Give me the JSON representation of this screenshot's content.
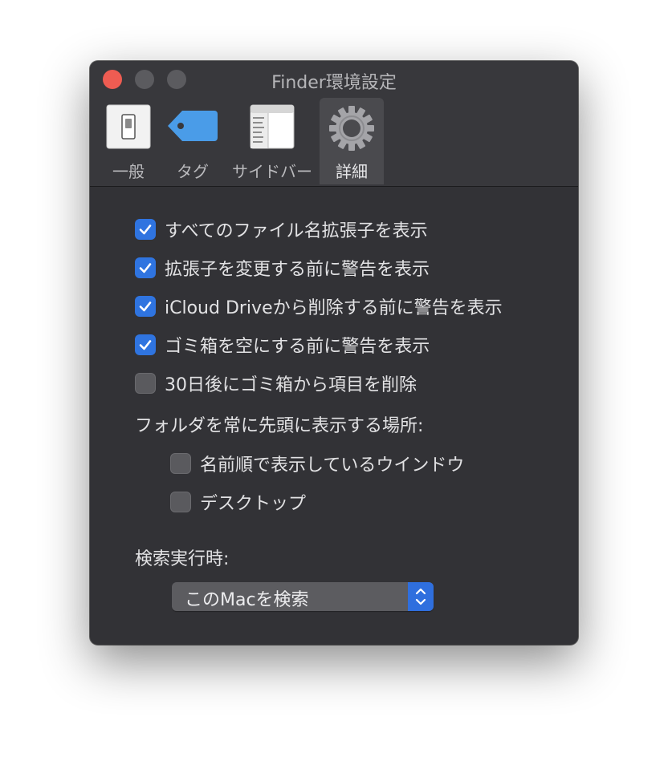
{
  "window": {
    "title": "Finder環境設定"
  },
  "toolbar": {
    "tabs": [
      {
        "label": "一般",
        "icon": "switch-icon",
        "selected": false
      },
      {
        "label": "タグ",
        "icon": "tag-icon",
        "selected": false
      },
      {
        "label": "サイドバー",
        "icon": "sidebar-icon",
        "selected": false
      },
      {
        "label": "詳細",
        "icon": "gear-icon",
        "selected": true
      }
    ]
  },
  "options": [
    {
      "label": "すべてのファイル名拡張子を表示",
      "checked": true
    },
    {
      "label": "拡張子を変更する前に警告を表示",
      "checked": true
    },
    {
      "label": "iCloud Driveから削除する前に警告を表示",
      "checked": true
    },
    {
      "label": "ゴミ箱を空にする前に警告を表示",
      "checked": true
    },
    {
      "label": "30日後にゴミ箱から項目を削除",
      "checked": false
    }
  ],
  "folders_first": {
    "label": "フォルダを常に先頭に表示する場所:",
    "items": [
      {
        "label": "名前順で表示しているウインドウ",
        "checked": false
      },
      {
        "label": "デスクトップ",
        "checked": false
      }
    ]
  },
  "search": {
    "label": "検索実行時:",
    "selected": "このMacを検索"
  },
  "colors": {
    "accent": "#2f74e0",
    "window_bg": "#323236",
    "close_button": "#ee5c52"
  }
}
